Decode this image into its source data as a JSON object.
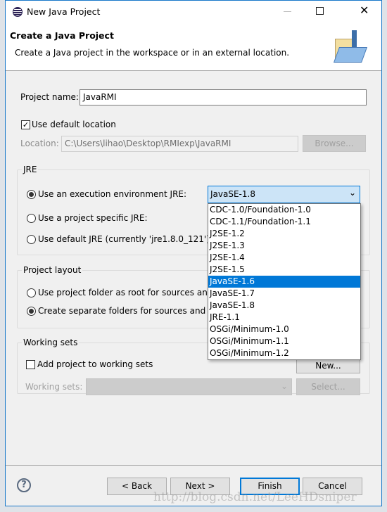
{
  "window": {
    "title": "New Java Project"
  },
  "header": {
    "title": "Create a Java Project",
    "description": "Create a Java project in the workspace or in an external location."
  },
  "project_name": {
    "label": "Project name:",
    "value": "JavaRMI"
  },
  "default_location": {
    "label": "Use default location",
    "checked": true
  },
  "location": {
    "label": "Location:",
    "value": "C:\\Users\\lihao\\Desktop\\RMIexp\\JavaRMI",
    "browse": "Browse..."
  },
  "jre": {
    "title": "JRE",
    "options": [
      {
        "label": "Use an execution environment JRE:",
        "selected": true
      },
      {
        "label": "Use a project specific JRE:",
        "selected": false
      },
      {
        "label": "Use default JRE (currently 'jre1.8.0_121')",
        "selected": false
      }
    ],
    "env_value": "JavaSE-1.8",
    "dropdown_items": [
      "CDC-1.0/Foundation-1.0",
      "CDC-1.1/Foundation-1.1",
      "J2SE-1.2",
      "J2SE-1.3",
      "J2SE-1.4",
      "J2SE-1.5",
      "JavaSE-1.6",
      "JavaSE-1.7",
      "JavaSE-1.8",
      "JRE-1.1",
      "OSGi/Minimum-1.0",
      "OSGi/Minimum-1.1",
      "OSGi/Minimum-1.2"
    ],
    "highlighted": "JavaSE-1.6"
  },
  "layout": {
    "title": "Project layout",
    "options": [
      {
        "label": "Use project folder as root for sources and class files",
        "selected": false
      },
      {
        "label": "Create separate folders for sources and class files",
        "selected": true
      }
    ]
  },
  "working_sets": {
    "title": "Working sets",
    "add_label": "Add project to working sets",
    "checked": false,
    "new": "New...",
    "sets_label": "Working sets:",
    "select": "Select..."
  },
  "footer": {
    "back": "< Back",
    "next": "Next >",
    "finish": "Finish",
    "cancel": "Cancel"
  },
  "watermark": "http://blog.csdn.net/LeeHDsniper",
  "colors": {
    "accent": "#0078d7",
    "border": "#1979ca"
  }
}
